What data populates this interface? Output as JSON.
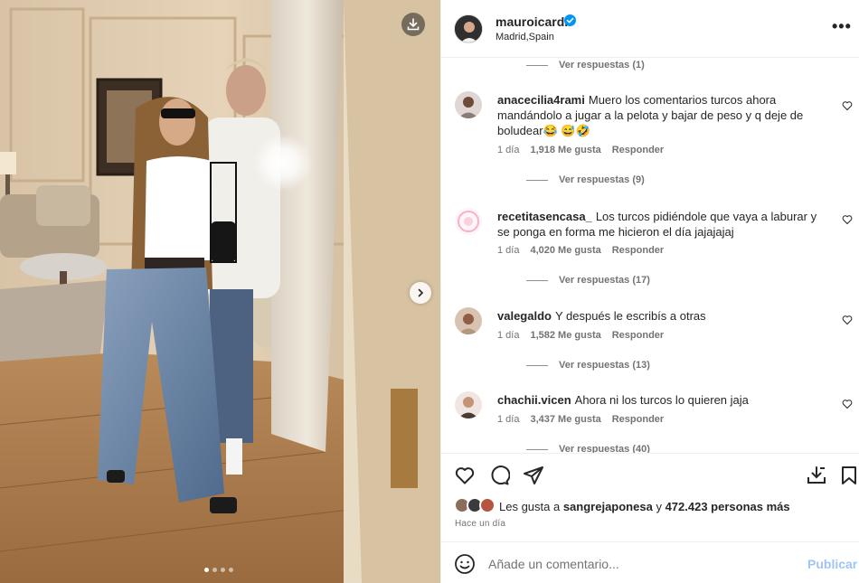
{
  "post": {
    "username": "mauroicardi",
    "location": "Madrid,Spain",
    "more_icon": "more-horizontal-icon",
    "more_label": "•••"
  },
  "media": {
    "carousel_slides": 4,
    "active_slide": 1
  },
  "comments": {
    "top_replies_label": "Ver respuestas (1)",
    "items": [
      {
        "user": "anacecilia4rami",
        "text": "Muero los comentarios turcos ahora mandándolo a jugar a la pelota y bajar de peso y q deje de boludear😂 😅🤣",
        "time": "1 día",
        "likes": "1,918 Me gusta",
        "reply": "Responder",
        "replies": "Ver respuestas (9)"
      },
      {
        "user": "recetitasencasa_",
        "text": "Los turcos pidiéndole que vaya a laburar y se ponga en forma me hicieron el día jajajajaj",
        "time": "1 día",
        "likes": "4,020 Me gusta",
        "reply": "Responder",
        "replies": "Ver respuestas (17)"
      },
      {
        "user": "valegaldo",
        "text": "Y después le escribís a otras",
        "time": "1 día",
        "likes": "1,582 Me gusta",
        "reply": "Responder",
        "replies": "Ver respuestas (13)"
      },
      {
        "user": "chachii.vicen",
        "text": "Ahora ni los turcos lo quieren jaja",
        "time": "1 día",
        "likes": "3,437 Me gusta",
        "reply": "Responder",
        "replies": "Ver respuestas (40)"
      }
    ]
  },
  "likes": {
    "prefix": "Les gusta a ",
    "user": "sangrejaponesa",
    "middle": " y ",
    "count": "472.423 personas más"
  },
  "time_ago": "Hace un día",
  "add_comment": {
    "placeholder": "Añade un comentario...",
    "post_label": "Publicar"
  },
  "colors": {
    "verified": "#0095f6",
    "post_button_disabled": "#a0c4f5",
    "secondary_text": "#737373"
  }
}
